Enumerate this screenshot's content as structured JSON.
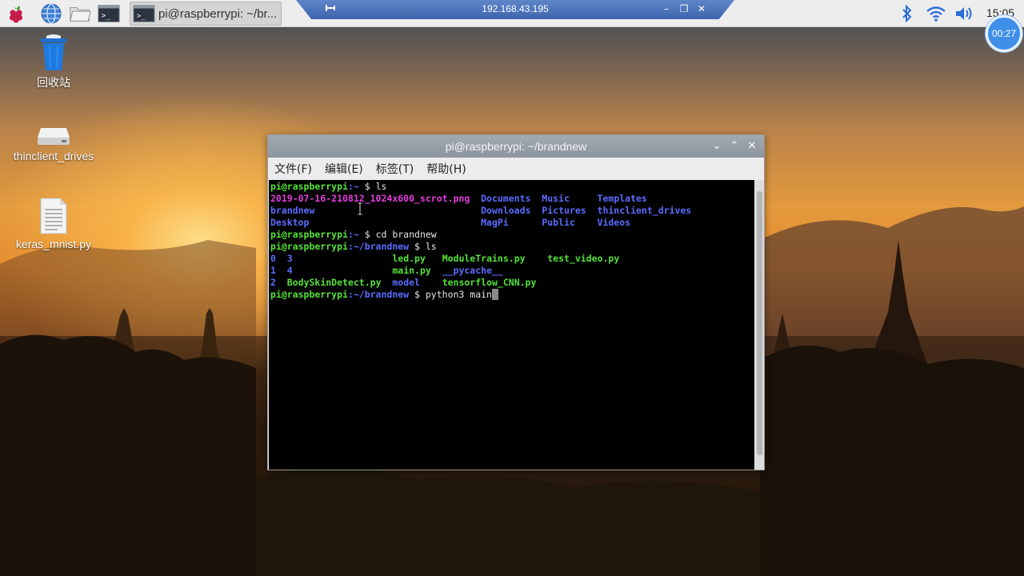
{
  "panel": {
    "launchers": [
      {
        "icon": "raspberry-menu-icon"
      },
      {
        "icon": "web-browser-icon"
      },
      {
        "icon": "file-manager-icon"
      },
      {
        "icon": "terminal-icon"
      }
    ],
    "task_label": "pi@raspberrypi: ~/br...",
    "tray": {
      "icons": [
        "bluetooth-icon",
        "wifi-icon",
        "volume-icon"
      ],
      "clock": "15:05"
    }
  },
  "remote_bar": {
    "ip": "192.168.43.195",
    "pin_icon": "pin-icon",
    "buttons": {
      "minimize": "–",
      "restore": "❐",
      "close": "✕"
    }
  },
  "timer": "00:27",
  "desktop_icons": [
    {
      "label": "回收站",
      "icon": "trash-icon"
    },
    {
      "label": "thinclient_drives",
      "icon": "drive-icon"
    },
    {
      "label": "keras_mnist.py",
      "icon": "text-file-icon"
    }
  ],
  "terminal": {
    "title": "pi@raspberrypi: ~/brandnew",
    "title_buttons": {
      "minimize": "⌄",
      "maximize": "⌃",
      "close": "✕"
    },
    "menu": [
      "文件(F)",
      "编辑(E)",
      "标签(T)",
      "帮助(H)"
    ],
    "prompt_home": "pi@raspberrypi",
    "lines": [
      {
        "prompt": "pi@raspberrypi",
        "path": ":~",
        "cmd": " $ ls"
      },
      {
        "cols": [
          {
            "t": "2019-07-16-210812_1024x600_scrot.png",
            "c": "magenta",
            "w": 38
          },
          {
            "t": "Documents",
            "c": "blue",
            "w": 11
          },
          {
            "t": "Music",
            "c": "blue",
            "w": 10
          },
          {
            "t": "Templates",
            "c": "blue",
            "w": 0
          }
        ]
      },
      {
        "cols": [
          {
            "t": "brandnew",
            "c": "blue",
            "w": 38
          },
          {
            "t": "Downloads",
            "c": "blue",
            "w": 11
          },
          {
            "t": "Pictures",
            "c": "blue",
            "w": 10
          },
          {
            "t": "thinclient_drives",
            "c": "blue",
            "w": 0
          }
        ]
      },
      {
        "cols": [
          {
            "t": "Desktop",
            "c": "blue",
            "w": 38
          },
          {
            "t": "MagPi",
            "c": "blue",
            "w": 11
          },
          {
            "t": "Public",
            "c": "blue",
            "w": 10
          },
          {
            "t": "Videos",
            "c": "blue",
            "w": 0
          }
        ]
      },
      {
        "prompt": "pi@raspberrypi",
        "path": ":~",
        "cmd": " $ cd brandnew"
      },
      {
        "prompt": "pi@raspberrypi",
        "path": ":~/brandnew",
        "cmd": " $ ls"
      },
      {
        "cols": [
          {
            "t": "0",
            "c": "blue",
            "w": 3
          },
          {
            "t": "3",
            "c": "blue",
            "w": 19
          },
          {
            "t": "led.py",
            "c": "green",
            "w": 9
          },
          {
            "t": "ModuleTrains.py",
            "c": "green",
            "w": 19
          },
          {
            "t": "test_video.py",
            "c": "green",
            "w": 0
          }
        ]
      },
      {
        "cols": [
          {
            "t": "1",
            "c": "blue",
            "w": 3
          },
          {
            "t": "4",
            "c": "blue",
            "w": 19
          },
          {
            "t": "main.py",
            "c": "green",
            "w": 9
          },
          {
            "t": "__pycache__",
            "c": "blue",
            "w": 0
          }
        ]
      },
      {
        "cols": [
          {
            "t": "2",
            "c": "blue",
            "w": 3
          },
          {
            "t": "BodySkinDetect.py",
            "c": "green",
            "w": 19
          },
          {
            "t": "model",
            "c": "blue",
            "w": 9
          },
          {
            "t": "tensorflow_CNN.py",
            "c": "green",
            "w": 0
          }
        ]
      },
      {
        "prompt": "pi@raspberrypi",
        "path": ":~/brandnew",
        "cmd": " $ python3 main",
        "cursor": true
      }
    ]
  }
}
